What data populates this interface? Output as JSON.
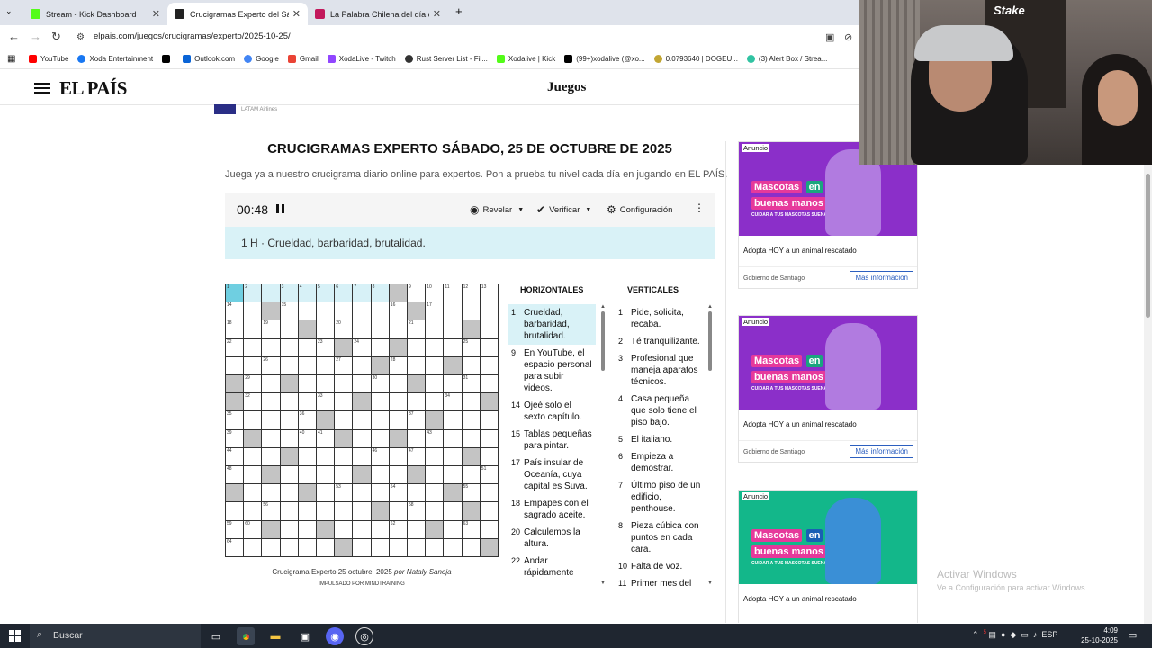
{
  "browser": {
    "tabs": [
      {
        "title": "Stream - Kick Dashboard",
        "color": "#53fc18"
      },
      {
        "title": "Crucigramas Experto del Sábado",
        "color": "#222222"
      },
      {
        "title": "La Palabra Chilena del día cu",
        "color": "#c2185b"
      }
    ],
    "new_tab": "+",
    "url": "elpais.com/juegos/crucigramas/experto/2025-10-25/",
    "bookmarks": [
      {
        "label": "YouTube",
        "color": "#ff0000"
      },
      {
        "label": "Xoda Entertainment",
        "color": "#1877f2"
      },
      {
        "label": "",
        "color": "#000000"
      },
      {
        "label": "Outlook.com",
        "color": "#0a64d6"
      },
      {
        "label": "Google",
        "color": "#4285f4"
      },
      {
        "label": "Gmail",
        "color": "#ea4335"
      },
      {
        "label": "XodaLive - Twitch",
        "color": "#9146ff"
      },
      {
        "label": "Rust Server List - Fil...",
        "color": "#333333"
      },
      {
        "label": "Xodalive | Kick",
        "color": "#53fc18"
      },
      {
        "label": "(99+)xodalive (@xo...",
        "color": "#000000"
      },
      {
        "label": "0.0793640 | DOGEU...",
        "color": "#c2a633"
      },
      {
        "label": "(3) Alert Box / Strea...",
        "color": "#31c3a2"
      }
    ]
  },
  "site": {
    "logo": "EL PAÍS",
    "section": "Juegos",
    "sponsor": "LATAM Airlines"
  },
  "puzzle": {
    "title": "CRUCIGRAMAS EXPERTO SÁBADO, 25 DE OCTUBRE DE 2025",
    "subtitle": "Juega ya a nuestro crucigrama diario online para expertos. Pon a prueba tu nivel cada día en jugando en EL PAÍS.",
    "timer": "00:48",
    "reveal": "Revelar",
    "verify": "Verificar",
    "settings": "Configuración",
    "current_clue": "1 H · Crueldad, barbaridad, brutalidad.",
    "caption_prefix": "Crucigrama Experto 25 octubre, 2025 ",
    "caption_author": "por Nataly Sanoja",
    "powered": "IMPULSADO POR MINDTRAINING",
    "horizontal_title": "HORIZONTALES",
    "vertical_title": "VERTICALES",
    "horizontales": [
      {
        "n": "1",
        "t": "Crueldad, barbaridad, brutalidad."
      },
      {
        "n": "9",
        "t": "En YouTube, el espacio personal para subir videos."
      },
      {
        "n": "14",
        "t": "Ojeé solo el sexto capítulo."
      },
      {
        "n": "15",
        "t": "Tablas pequeñas para pintar."
      },
      {
        "n": "17",
        "t": "País insular de Oceanía, cuya capital es Suva."
      },
      {
        "n": "18",
        "t": "Empapes con el sagrado aceite."
      },
      {
        "n": "20",
        "t": "Calculemos la altura."
      },
      {
        "n": "22",
        "t": "Andar rápidamente"
      }
    ],
    "verticales": [
      {
        "n": "1",
        "t": "Pide, solicita, recaba."
      },
      {
        "n": "2",
        "t": "Té tranquilizante."
      },
      {
        "n": "3",
        "t": "Profesional que maneja aparatos técnicos."
      },
      {
        "n": "4",
        "t": "Casa pequeña que solo tiene el piso bajo."
      },
      {
        "n": "5",
        "t": "El italiano."
      },
      {
        "n": "6",
        "t": "Empieza a demostrar."
      },
      {
        "n": "7",
        "t": "Último piso de un edificio, penthouse."
      },
      {
        "n": "8",
        "t": "Pieza cúbica con puntos en cada cara."
      },
      {
        "n": "10",
        "t": "Falta de voz."
      },
      {
        "n": "11",
        "t": "Primer mes del"
      }
    ],
    "grid_size": 15
  },
  "ads": [
    {
      "tag": "Anuncio",
      "line1": "Mascotas",
      "line1b": "en",
      "line2": "buenas manos",
      "line3": "CUIDAR A TUS MASCOTAS SUENA BIEN",
      "text": "Adopta HOY a un animal rescatado",
      "org": "Gobierno de Santiago",
      "more": "Más información",
      "bg": "#8b2fc9",
      "accent": "#e6399b"
    },
    {
      "tag": "Anuncio",
      "line1": "Mascotas",
      "line1b": "en",
      "line2": "buenas manos",
      "line3": "CUIDAR A TUS MASCOTAS SUENA BIEN",
      "text": "Adopta HOY a un animal rescatado",
      "org": "Gobierno de Santiago",
      "more": "Más información",
      "bg": "#8b2fc9",
      "accent": "#e6399b"
    },
    {
      "tag": "Anuncio",
      "line1": "Mascotas",
      "line1b": "en",
      "line2": "buenas manos",
      "line3": "CUIDAR A TUS MASCOTAS SUENA BIEN",
      "text": "Adopta HOY a un animal rescatado",
      "org": "",
      "more": "",
      "bg": "#13b78a",
      "accent": "#e6399b"
    }
  ],
  "stream": {
    "overlay": "Stake"
  },
  "watermark": {
    "line1": "Activar Windows",
    "line2": "Ve a Configuración para activar Windows."
  },
  "taskbar": {
    "search": "Buscar",
    "lang": "ESP",
    "time": "4:09",
    "date": "25-10-2025",
    "notif_count": "5"
  }
}
